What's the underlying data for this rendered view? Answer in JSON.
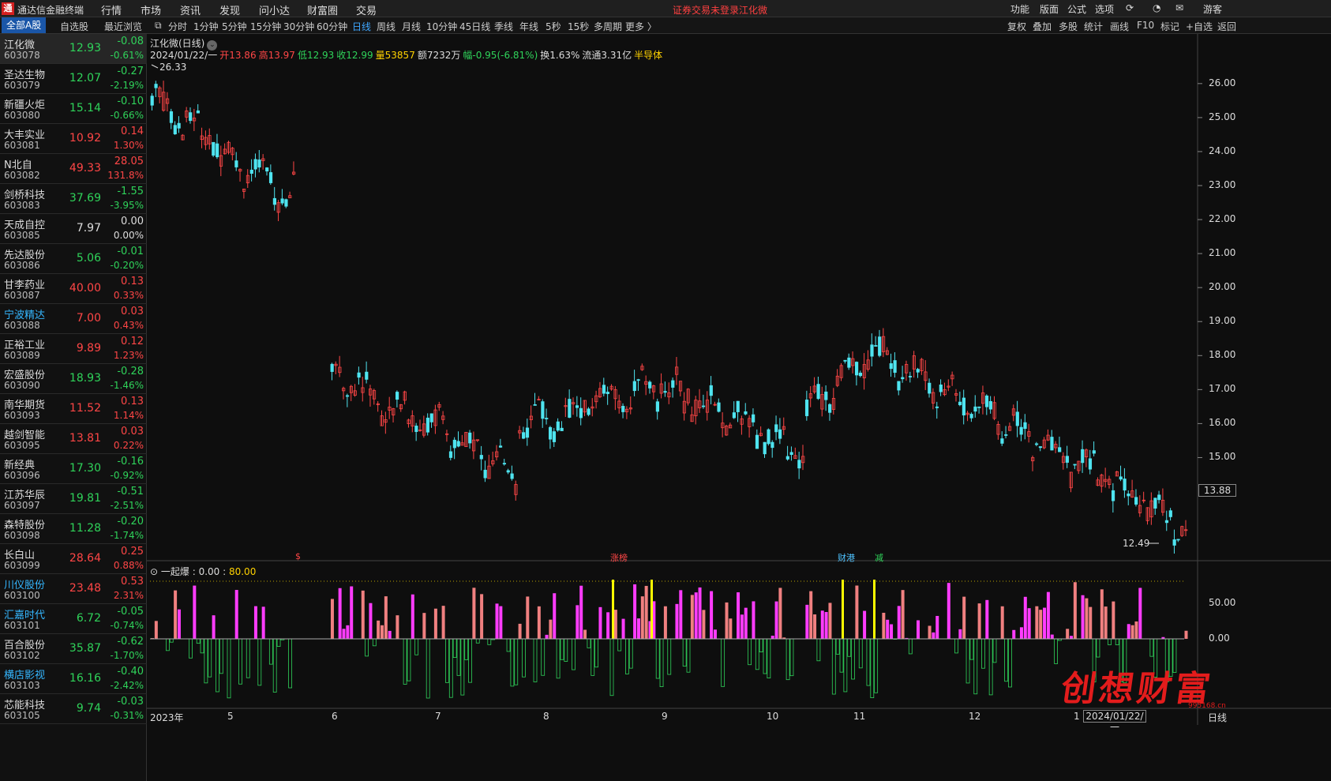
{
  "app": {
    "logo": "通",
    "title": "通达信金融终端"
  },
  "menu": [
    "行情",
    "市场",
    "资讯",
    "发现",
    "问小达",
    "财富圈",
    "交易"
  ],
  "notice": {
    "login": "证券交易未登录",
    "stock": "江化微"
  },
  "menu_right": [
    "功能",
    "版面",
    "公式",
    "选项",
    "游客"
  ],
  "list_tabs": [
    "全部A股",
    "自选股",
    "最近浏览"
  ],
  "period_tabs": [
    "分时",
    "1分钟",
    "5分钟",
    "15分钟",
    "30分钟",
    "60分钟",
    "日线",
    "周线",
    "月线",
    "10分钟",
    "45日线",
    "季线",
    "年线",
    "5秒",
    "15秒",
    "多周期",
    "更多 〉"
  ],
  "active_period": "日线",
  "tool_tabs": [
    "复权",
    "叠加",
    "多股",
    "统计",
    "画线",
    "F10",
    "标记",
    "+自选",
    "返回"
  ],
  "stocks": [
    {
      "name": "江化微",
      "code": "603078",
      "price": "12.93",
      "change": "-0.08",
      "pct": "-0.61%",
      "dir": "dn",
      "sel": true
    },
    {
      "name": "圣达生物",
      "code": "603079",
      "price": "12.07",
      "change": "-0.27",
      "pct": "-2.19%",
      "dir": "dn"
    },
    {
      "name": "新疆火炬",
      "code": "603080",
      "price": "15.14",
      "change": "-0.10",
      "pct": "-0.66%",
      "dir": "dn"
    },
    {
      "name": "大丰实业",
      "code": "603081",
      "price": "10.92",
      "change": "0.14",
      "pct": "1.30%",
      "dir": "up"
    },
    {
      "name": "N北自",
      "code": "603082",
      "price": "49.33",
      "change": "28.05",
      "pct": "131.8%",
      "dir": "up"
    },
    {
      "name": "剑桥科技",
      "code": "603083",
      "price": "37.69",
      "change": "-1.55",
      "pct": "-3.95%",
      "dir": "dn"
    },
    {
      "name": "天成自控",
      "code": "603085",
      "price": "7.97",
      "change": "0.00",
      "pct": "0.00%",
      "dir": "eq"
    },
    {
      "name": "先达股份",
      "code": "603086",
      "price": "5.06",
      "change": "-0.01",
      "pct": "-0.20%",
      "dir": "dn"
    },
    {
      "name": "甘李药业",
      "code": "603087",
      "price": "40.00",
      "change": "0.13",
      "pct": "0.33%",
      "dir": "up"
    },
    {
      "name": "宁波精达",
      "code": "603088",
      "price": "7.00",
      "change": "0.03",
      "pct": "0.43%",
      "dir": "up",
      "hl": true
    },
    {
      "name": "正裕工业",
      "code": "603089",
      "price": "9.89",
      "change": "0.12",
      "pct": "1.23%",
      "dir": "up"
    },
    {
      "name": "宏盛股份",
      "code": "603090",
      "price": "18.93",
      "change": "-0.28",
      "pct": "-1.46%",
      "dir": "dn"
    },
    {
      "name": "南华期货",
      "code": "603093",
      "price": "11.52",
      "change": "0.13",
      "pct": "1.14%",
      "dir": "up"
    },
    {
      "name": "越剑智能",
      "code": "603095",
      "price": "13.81",
      "change": "0.03",
      "pct": "0.22%",
      "dir": "up"
    },
    {
      "name": "新经典",
      "code": "603096",
      "price": "17.30",
      "change": "-0.16",
      "pct": "-0.92%",
      "dir": "dn"
    },
    {
      "name": "江苏华辰",
      "code": "603097",
      "price": "19.81",
      "change": "-0.51",
      "pct": "-2.51%",
      "dir": "dn"
    },
    {
      "name": "森特股份",
      "code": "603098",
      "price": "11.28",
      "change": "-0.20",
      "pct": "-1.74%",
      "dir": "dn"
    },
    {
      "name": "长白山",
      "code": "603099",
      "price": "28.64",
      "change": "0.25",
      "pct": "0.88%",
      "dir": "up"
    },
    {
      "name": "川仪股份",
      "code": "603100",
      "price": "23.48",
      "change": "0.53",
      "pct": "2.31%",
      "dir": "up",
      "hl": true
    },
    {
      "name": "汇嘉时代",
      "code": "603101",
      "price": "6.72",
      "change": "-0.05",
      "pct": "-0.74%",
      "dir": "dn",
      "hl": true
    },
    {
      "name": "百合股份",
      "code": "603102",
      "price": "35.87",
      "change": "-0.62",
      "pct": "-1.70%",
      "dir": "dn"
    },
    {
      "name": "横店影视",
      "code": "603103",
      "price": "16.16",
      "change": "-0.40",
      "pct": "-2.42%",
      "dir": "dn",
      "hl": true
    },
    {
      "name": "芯能科技",
      "code": "603105",
      "price": "9.74",
      "change": "-0.03",
      "pct": "-0.31%",
      "dir": "dn"
    }
  ],
  "chart_header": {
    "title": "江化微(日线)"
  },
  "ohlc": {
    "date": "2024/01/22/一",
    "open": "开13.86",
    "high": "高13.97",
    "low": "低12.93",
    "close": "收12.99",
    "vol": "量53857",
    "amount": "额7232万",
    "range": "幅-0.95(-6.81%)",
    "turnover": "换1.63%",
    "float": "流通3.31亿",
    "sector": "半导体"
  },
  "price_axis": [
    "26.00",
    "25.00",
    "24.00",
    "23.00",
    "22.00",
    "21.00",
    "20.00",
    "19.00",
    "18.00",
    "17.00",
    "16.00",
    "15.00",
    "13.88"
  ],
  "indicator_axis": [
    "50.00",
    "0.00"
  ],
  "x_labels": [
    "2023年",
    "5",
    "6",
    "7",
    "8",
    "9",
    "10",
    "11",
    "12",
    "1"
  ],
  "high_marker": "26.33",
  "low_marker": "12.49",
  "current_price_tag": "13.88",
  "event_flags": [
    "$",
    "涨榜",
    "财港",
    "减"
  ],
  "indicator": {
    "name": "一起爆",
    "v1": "0.00",
    "v2": "80.00"
  },
  "bottom_date": "2024/01/22/一",
  "bottom_period": "日线",
  "watermark": {
    "text": "创想财富",
    "url": "995168.cn"
  },
  "colors": {
    "up": "#ff4646",
    "down": "#4fe4f0",
    "pos_bar": "#ff3cff",
    "pos_bar2": "#f08080",
    "neg_bar": "#2fd35a",
    "spike": "#ffff00"
  },
  "chart_data": {
    "type": "candlestick",
    "title": "江化微(日线)",
    "ylim": [
      12.2,
      26.6
    ],
    "segments": [
      {
        "from": 0,
        "to": 35,
        "start": 25.6,
        "end": 22.6
      },
      {
        "from": 36,
        "to": 37,
        "start": 22.8,
        "end": 23.0
      },
      {
        "from": 38,
        "to": 46,
        "start": 23.0,
        "end": 23.0,
        "gap": true
      },
      {
        "from": 47,
        "to": 95,
        "start": 17.6,
        "end": 14.5
      },
      {
        "from": 96,
        "to": 130,
        "start": 15.8,
        "end": 17.2
      },
      {
        "from": 131,
        "to": 170,
        "start": 17.2,
        "end": 15.2
      },
      {
        "from": 171,
        "to": 188,
        "start": 16.3,
        "end": 18.2
      },
      {
        "from": 189,
        "to": 270,
        "start": 18.2,
        "end": 12.99
      }
    ]
  }
}
